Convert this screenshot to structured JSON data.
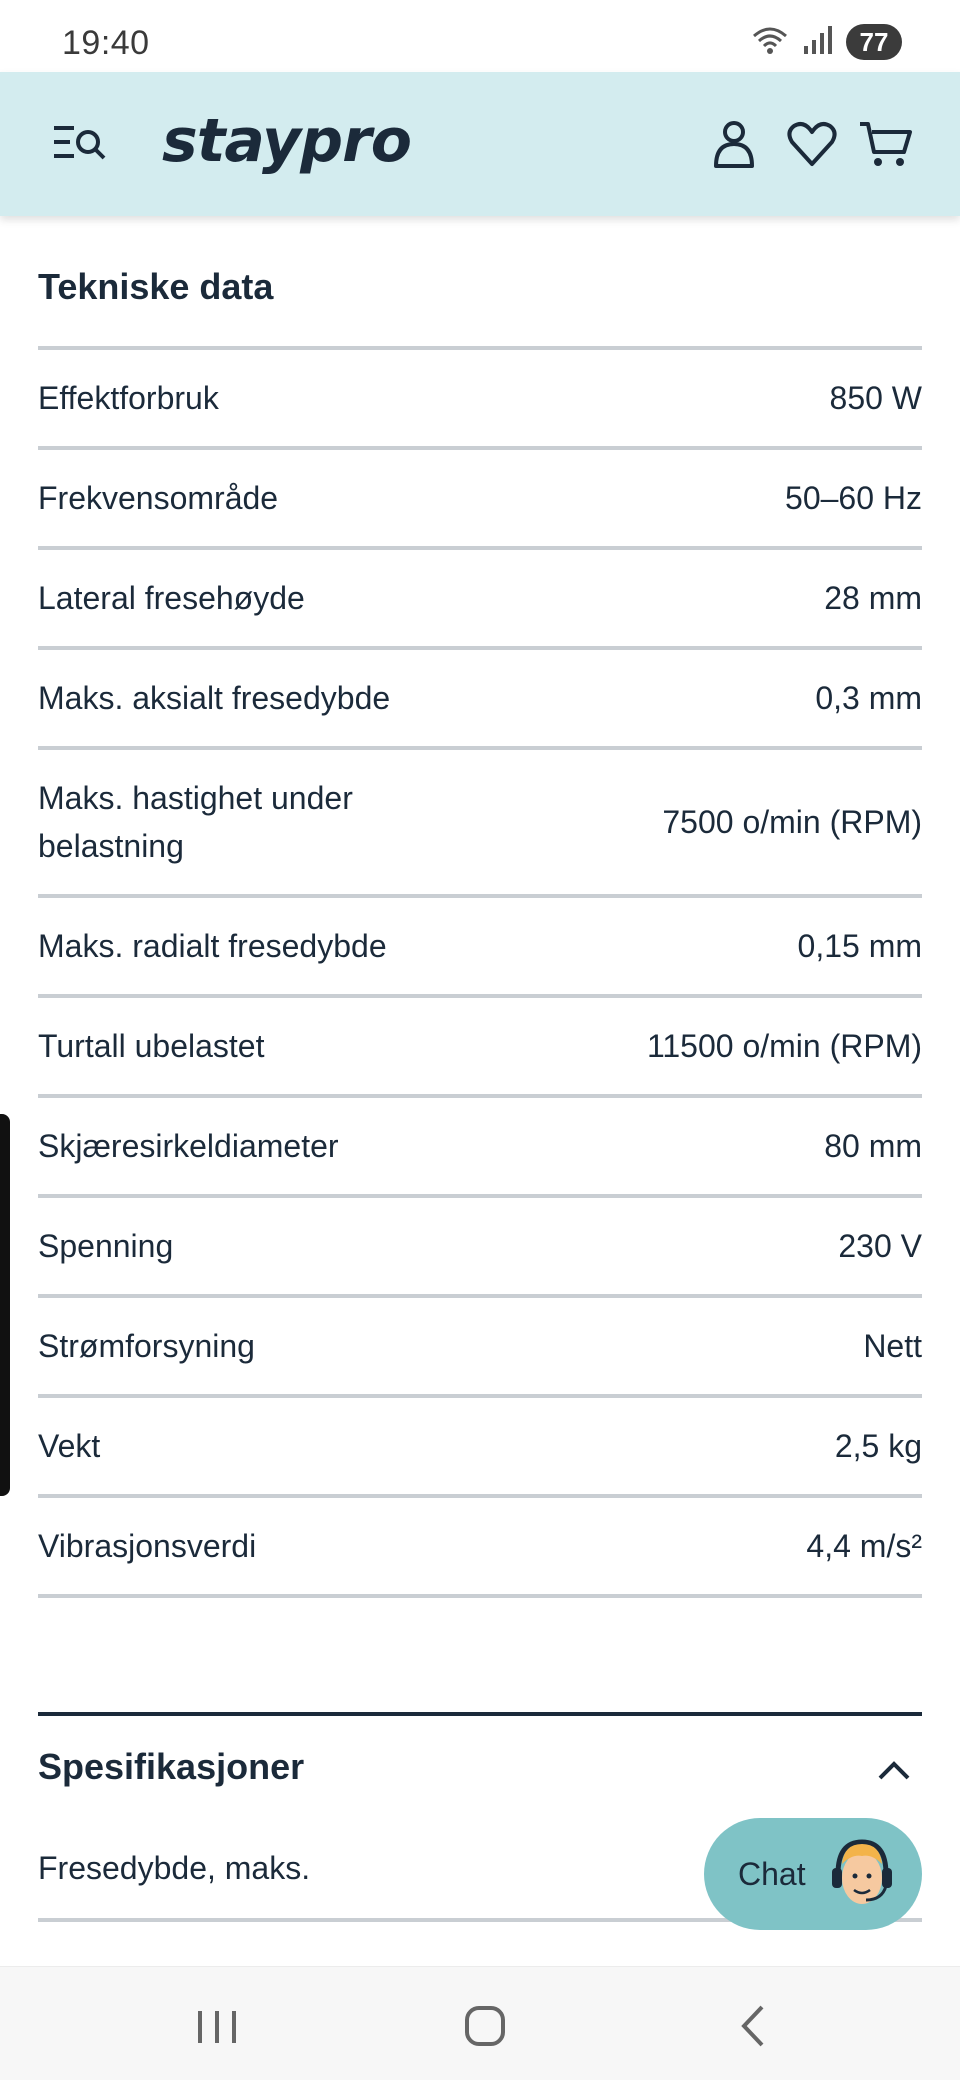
{
  "status_bar": {
    "time": "19:40",
    "battery": "77"
  },
  "header": {
    "logo": "staypro"
  },
  "technical_data": {
    "title": "Tekniske data",
    "rows": [
      {
        "label": "Effektforbruk",
        "value": "850 W"
      },
      {
        "label": "Frekvensområde",
        "value": "50–60 Hz"
      },
      {
        "label": "Lateral fresehøyde",
        "value": "28 mm"
      },
      {
        "label": "Maks. aksialt fresedybde",
        "value": "0,3 mm"
      },
      {
        "label": "Maks. hastighet under belastning",
        "value": "7500 o/min (RPM)"
      },
      {
        "label": "Maks. radialt fresedybde",
        "value": "0,15 mm"
      },
      {
        "label": "Turtall ubelastet",
        "value": "11500 o/min (RPM)"
      },
      {
        "label": "Skjæresirkeldiameter",
        "value": "80 mm"
      },
      {
        "label": "Spenning",
        "value": "230 V"
      },
      {
        "label": "Strømforsyning",
        "value": "Nett"
      },
      {
        "label": "Vekt",
        "value": "2,5 kg"
      },
      {
        "label": "Vibrasjonsverdi",
        "value": "4,4 m/s²"
      }
    ]
  },
  "specifications": {
    "title": "Spesifikasjoner",
    "first_row_label": "Fresedybde, maks."
  },
  "chat": {
    "label": "Chat"
  },
  "icons": {
    "menu": "menu-search-icon",
    "account": "user-icon",
    "wishlist": "heart-icon",
    "cart": "cart-icon",
    "collapse": "chevron-up-icon",
    "chat_avatar": "support-agent-icon",
    "nav_recents": "recent-apps-icon",
    "nav_home": "home-icon",
    "nav_back": "back-icon"
  },
  "colors": {
    "header_bg": "#d3ecef",
    "text": "#1b2a3a",
    "chat_bg": "#7fc3c6",
    "divider": "#c9ced3"
  }
}
